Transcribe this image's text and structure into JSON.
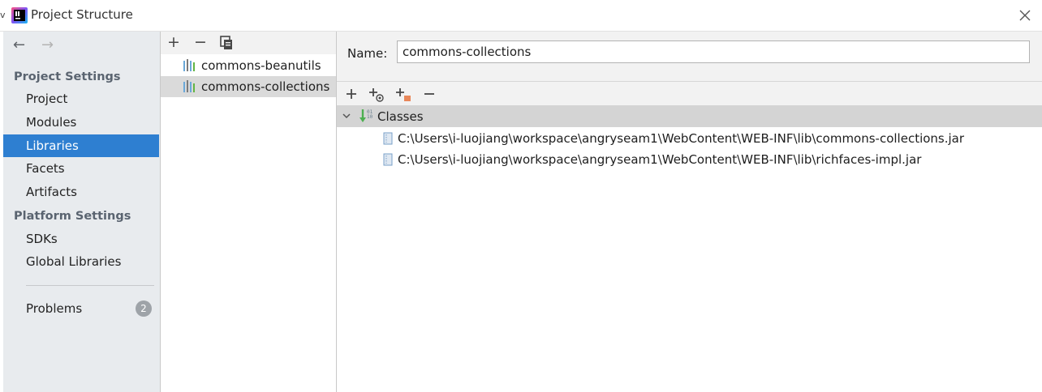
{
  "window": {
    "title": "Project Structure",
    "left_edge_glyph": "v"
  },
  "sidebar": {
    "sections": [
      {
        "heading": "Project Settings",
        "items": [
          "Project",
          "Modules",
          "Libraries",
          "Facets",
          "Artifacts"
        ]
      },
      {
        "heading": "Platform Settings",
        "items": [
          "SDKs",
          "Global Libraries"
        ]
      }
    ],
    "selected_item": "Libraries",
    "problems": {
      "label": "Problems",
      "count": "2"
    }
  },
  "libraries": {
    "toolbar": {
      "add": "+",
      "remove": "−",
      "copy": "copy-icon"
    },
    "items": [
      "commons-beanutils",
      "commons-collections"
    ],
    "selected_item": "commons-collections"
  },
  "detail": {
    "name_label": "Name:",
    "name_value": "commons-collections",
    "classes_label": "Classes",
    "paths": [
      "C:\\Users\\i-luojiang\\workspace\\angryseam1\\WebContent\\WEB-INF\\lib\\commons-collections.jar",
      "C:\\Users\\i-luojiang\\workspace\\angryseam1\\WebContent\\WEB-INF\\lib\\richfaces-impl.jar"
    ]
  },
  "colors": {
    "selection": "#2e7fd1",
    "sidebar_bg": "#e8ebee",
    "toolbar_bg": "#f2f2f2",
    "classes_header_bg": "#d4d4d4",
    "library_selection": "#dadada",
    "badge": "#9ea3a8"
  }
}
